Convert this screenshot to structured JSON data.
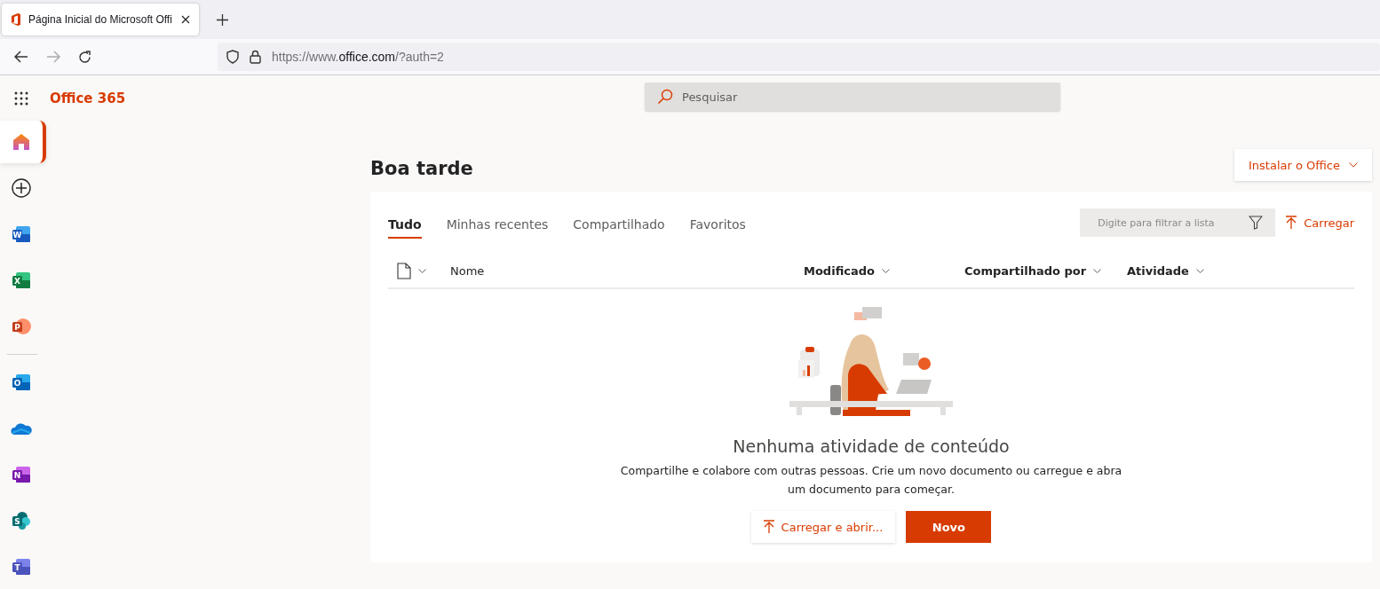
{
  "browser": {
    "tabs": [
      {
        "title": "Página Inicial do Microsoft Offi",
        "selected": true
      }
    ],
    "url_parts": [
      {
        "text": "https://www.",
        "kind": "dim"
      },
      {
        "text": "office.com",
        "kind": "host"
      },
      {
        "text": "/?auth=2",
        "kind": "dim"
      }
    ]
  },
  "header": {
    "app_name": "Office 365",
    "search": {
      "placeholder": "Pesquisar"
    }
  },
  "sidebar": {
    "items": [
      {
        "kind": "home",
        "selected": true
      },
      {
        "kind": "create",
        "selected": false
      },
      {
        "kind": "word",
        "letter": "W",
        "selected": false
      },
      {
        "kind": "excel",
        "letter": "X",
        "selected": false
      },
      {
        "kind": "powerpoint",
        "letter": "P",
        "selected": false
      },
      {
        "kind": "divider"
      },
      {
        "kind": "outlook",
        "letter": "O",
        "selected": false
      },
      {
        "kind": "onedrive",
        "selected": false
      },
      {
        "kind": "onenote",
        "letter": "N",
        "selected": false
      },
      {
        "kind": "sharepoint",
        "letter": "S",
        "selected": false
      },
      {
        "kind": "teams",
        "letter": "T",
        "selected": false
      }
    ]
  },
  "greeting": "Boa tarde",
  "install_button": "Instalar o Office",
  "tabs": [
    {
      "label": "Tudo",
      "selected": true
    },
    {
      "label": "Minhas recentes",
      "selected": false
    },
    {
      "label": "Compartilhado",
      "selected": false
    },
    {
      "label": "Favoritos",
      "selected": false
    }
  ],
  "filter": {
    "placeholder": "Digite para filtrar a lista"
  },
  "upload_button": "Carregar",
  "columns": [
    "Nome",
    "Modificado",
    "Compartilhado por",
    "Atividade"
  ],
  "empty": {
    "title": "Nenhuma atividade de conteúdo",
    "text": "Compartilhe e colabore com outras pessoas. Crie um novo documento ou carregue e abra um documento para começar.",
    "upload_open_button": "Carregar e abrir...",
    "new_button": "Novo"
  }
}
